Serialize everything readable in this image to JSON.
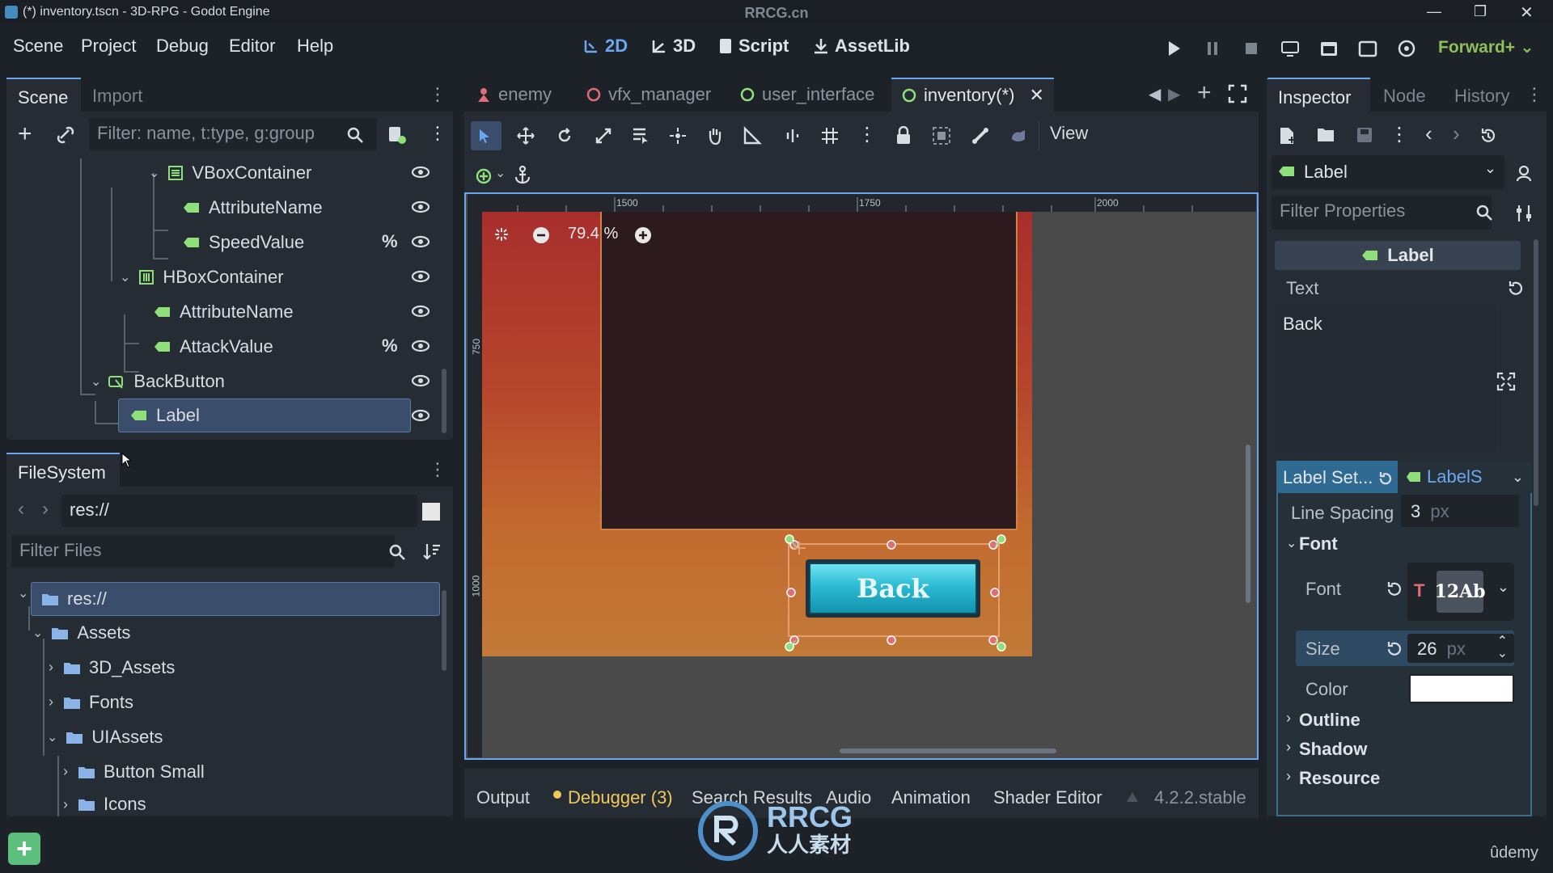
{
  "window": {
    "title": "(*) inventory.tscn - 3D-RPG - Godot Engine",
    "watermark": "RRCG.cn"
  },
  "menu": [
    "Scene",
    "Project",
    "Debug",
    "Editor",
    "Help"
  ],
  "workspaces": [
    {
      "label": "2D",
      "active": true
    },
    {
      "label": "3D",
      "active": false
    },
    {
      "label": "Script",
      "active": false
    },
    {
      "label": "AssetLib",
      "active": false
    }
  ],
  "renderer": "Forward+",
  "scene_dock": {
    "tabs": [
      "Scene",
      "Import"
    ],
    "filter_placeholder": "Filter: name, t:type, g:group",
    "nodes": [
      {
        "label": "VBoxContainer",
        "icon": "vbox-icon",
        "pct": false
      },
      {
        "label": "AttributeName",
        "icon": "label-icon",
        "pct": false
      },
      {
        "label": "SpeedValue",
        "icon": "label-icon",
        "pct": true
      },
      {
        "label": "HBoxContainer",
        "icon": "hbox-icon",
        "pct": false
      },
      {
        "label": "AttributeName",
        "icon": "label-icon",
        "pct": false
      },
      {
        "label": "AttackValue",
        "icon": "label-icon",
        "pct": true
      },
      {
        "label": "BackButton",
        "icon": "button-icon",
        "pct": false
      },
      {
        "label": "Label",
        "icon": "label-icon",
        "pct": false,
        "selected": true
      }
    ],
    "pct_symbol": "%"
  },
  "filesystem": {
    "title": "FileSystem",
    "path": "res://",
    "filter_placeholder": "Filter Files",
    "items": [
      "res://",
      "Assets",
      "3D_Assets",
      "Fonts",
      "UIAssets",
      "Button Small",
      "Icons"
    ]
  },
  "editor_tabs": [
    {
      "label": "enemy",
      "icon_color": "#e06c75"
    },
    {
      "label": "vfx_manager",
      "icon_color": "#e06c75"
    },
    {
      "label": "user_interface",
      "icon_color": "#8fe07a"
    },
    {
      "label": "inventory(*)",
      "icon_color": "#8fe07a",
      "active": true
    }
  ],
  "toolbar": {
    "view_label": "View"
  },
  "viewport": {
    "zoom": "79.4 %",
    "ruler_labels": [
      "1500",
      "1750",
      "2000"
    ],
    "ruler_v_labels": [
      "750",
      "1000"
    ],
    "button_text": "Back"
  },
  "bottom_tabs": [
    "Output",
    "Debugger (3)",
    "Search Results",
    "Audio",
    "Animation",
    "Shader Editor"
  ],
  "version": "4.2.2.stable",
  "inspector": {
    "tabs": [
      "Inspector",
      "Node",
      "History"
    ],
    "node_type": "Label",
    "filter_placeholder": "Filter Properties",
    "class_header": "Label",
    "text_label": "Text",
    "text_value": "Back",
    "label_settings": "Label Set...",
    "label_settings_value": "LabelS",
    "line_spacing_label": "Line Spacing",
    "line_spacing_value": "3",
    "unit_px": "px",
    "font_section": "Font",
    "font_label": "Font",
    "font_preview": "12Ab",
    "size_label": "Size",
    "size_value": "26",
    "color_label": "Color",
    "color_value": "#ffffff",
    "outline_section": "Outline",
    "shadow_section": "Shadow",
    "resource_section": "Resource"
  },
  "brand": "ûdemy",
  "overlay_logo": {
    "top": "RRCG",
    "bottom": "人人素材"
  }
}
